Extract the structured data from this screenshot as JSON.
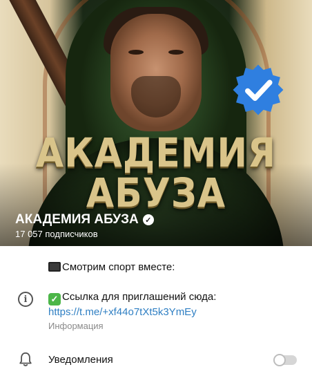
{
  "channel": {
    "name": "АКАДЕМИЯ АБУЗА",
    "subscribers": "17 057 подписчиков",
    "poster_line1": "АКАДЕМИЯ",
    "poster_line2": "АБУЗА",
    "verified_color": "#2f7fe0"
  },
  "info": {
    "line1": "Смотрим спорт вместе:",
    "line2": "Ссылка для приглашений сюда:",
    "link": "https://t.me/+xf44o7tXt5k3YmEy",
    "caption": "Информация",
    "icons": {
      "tv": "television-emoji",
      "check": "check-mark-emoji",
      "info": "info-icon"
    }
  },
  "notifications": {
    "label": "Уведомления",
    "enabled": false,
    "icon": "bell-icon"
  }
}
